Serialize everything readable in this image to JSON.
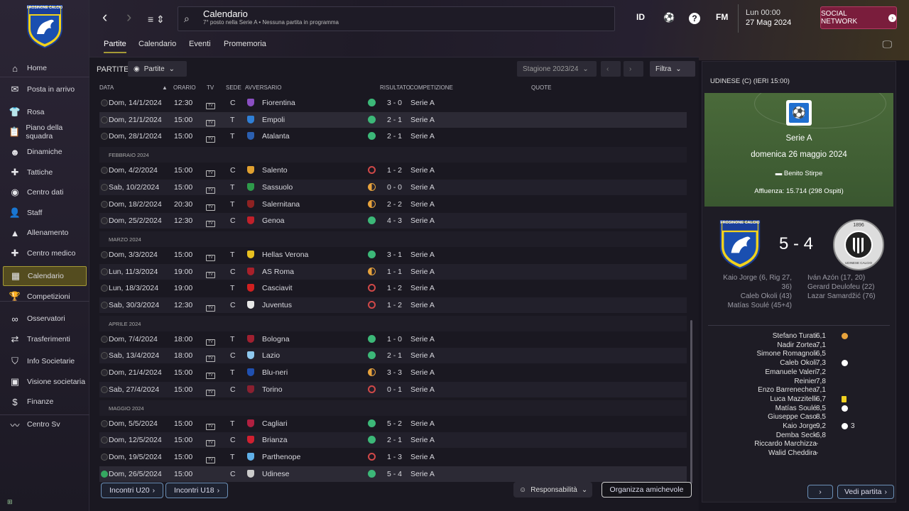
{
  "club_logo_text": "FROSINONE CALCIO",
  "sidebar": [
    {
      "label": "Home",
      "icon": "home-icon",
      "glyph": "⌂"
    },
    {
      "label": "Posta in arrivo",
      "icon": "mail-icon",
      "glyph": "✉"
    },
    {
      "label": "Rosa",
      "icon": "squad-icon",
      "glyph": "👕"
    },
    {
      "label": "Piano della squadra",
      "icon": "clipboard-icon",
      "glyph": "📋"
    },
    {
      "label": "Dinamiche",
      "icon": "dynamics-icon",
      "glyph": "☻"
    },
    {
      "label": "Tattiche",
      "icon": "tactics-icon",
      "glyph": "✚"
    },
    {
      "label": "Centro dati",
      "icon": "data-icon",
      "glyph": "◉"
    },
    {
      "label": "Staff",
      "icon": "staff-icon",
      "glyph": "👤"
    },
    {
      "label": "Allenamento",
      "icon": "training-icon",
      "glyph": "▲"
    },
    {
      "label": "Centro medico",
      "icon": "medical-icon",
      "glyph": "✚"
    },
    {
      "label": "Calendario",
      "icon": "calendar-icon",
      "glyph": "▦",
      "active": true
    },
    {
      "label": "Competizioni",
      "icon": "trophy-icon",
      "glyph": "🏆"
    },
    {
      "label": "Osservatori",
      "icon": "binoculars-icon",
      "glyph": "∞"
    },
    {
      "label": "Trasferimenti",
      "icon": "transfers-icon",
      "glyph": "⇄"
    },
    {
      "label": "Info Societarie",
      "icon": "shield-icon",
      "glyph": "⛉"
    },
    {
      "label": "Visione societaria",
      "icon": "briefcase-icon",
      "glyph": "▣"
    },
    {
      "label": "Finanze",
      "icon": "finance-icon",
      "glyph": "$"
    },
    {
      "label": "Centro Sv",
      "icon": "development-icon",
      "glyph": "〰"
    }
  ],
  "header": {
    "title": "Calendario",
    "subtitle": "7° posto nella Serie A • Nessuna partita in programma",
    "id_label": "ID",
    "fm_label": "FM",
    "help": "?",
    "day_time": "Lun 00:00",
    "date": "27 Mag 2024",
    "social": "SOCIAL NETWORK"
  },
  "tabs": [
    "Partite",
    "Calendario",
    "Eventi",
    "Promemoria"
  ],
  "list": {
    "heading": "PARTITE",
    "view_btn": "Partite",
    "season": "Stagione 2023/24",
    "filter": "Filtra",
    "columns": {
      "date": "DATA",
      "time": "ORARIO",
      "tv": "TV",
      "venue": "SEDE",
      "opp": "AVVERSARIO",
      "res": "RISULTATO",
      "comp": "COMPETIZIONE",
      "odds": "QUOTE"
    }
  },
  "matches": [
    {
      "type": "m",
      "date": "Dom, 14/1/2024",
      "time": "12:30",
      "tv": true,
      "venue": "C",
      "opp": "Fiorentina",
      "crest": "#8a4fc2",
      "r": "W",
      "score": "3 - 0",
      "comp": "Serie A"
    },
    {
      "type": "m",
      "date": "Dom, 21/1/2024",
      "time": "15:00",
      "tv": true,
      "venue": "T",
      "opp": "Empoli",
      "crest": "#2f7fd6",
      "r": "W",
      "score": "2 - 1",
      "comp": "Serie A"
    },
    {
      "type": "m",
      "date": "Dom, 28/1/2024",
      "time": "15:00",
      "tv": true,
      "venue": "T",
      "opp": "Atalanta",
      "crest": "#2b5fb0",
      "r": "W",
      "score": "2 - 1",
      "comp": "Serie A"
    },
    {
      "type": "h",
      "label": "FEBBRAIO 2024"
    },
    {
      "type": "m",
      "date": "Dom, 4/2/2024",
      "time": "15:00",
      "tv": true,
      "venue": "C",
      "opp": "Salento",
      "crest": "#e0a030",
      "r": "L",
      "score": "1 - 2",
      "comp": "Serie A"
    },
    {
      "type": "m",
      "date": "Sab, 10/2/2024",
      "time": "15:00",
      "tv": true,
      "venue": "T",
      "opp": "Sassuolo",
      "crest": "#2e9a4a",
      "r": "D",
      "score": "0 - 0",
      "comp": "Serie A"
    },
    {
      "type": "m",
      "date": "Dom, 18/2/2024",
      "time": "20:30",
      "tv": true,
      "venue": "T",
      "opp": "Salernitana",
      "crest": "#8e2222",
      "r": "D",
      "score": "2 - 2",
      "comp": "Serie A"
    },
    {
      "type": "m",
      "date": "Dom, 25/2/2024",
      "time": "12:30",
      "tv": true,
      "venue": "C",
      "opp": "Genoa",
      "crest": "#c0202a",
      "r": "W",
      "score": "4 - 3",
      "comp": "Serie A"
    },
    {
      "type": "h",
      "label": "MARZO 2024"
    },
    {
      "type": "m",
      "date": "Dom, 3/3/2024",
      "time": "15:00",
      "tv": true,
      "venue": "T",
      "opp": "Hellas Verona",
      "crest": "#e8c020",
      "r": "W",
      "score": "3 - 1",
      "comp": "Serie A"
    },
    {
      "type": "m",
      "date": "Lun, 11/3/2024",
      "time": "19:00",
      "tv": true,
      "venue": "C",
      "opp": "AS Roma",
      "crest": "#a8202a",
      "r": "D",
      "score": "1 - 1",
      "comp": "Serie A"
    },
    {
      "type": "m",
      "date": "Lun, 18/3/2024",
      "time": "19:00",
      "tv": false,
      "venue": "T",
      "opp": "Casciavit",
      "crest": "#d02020",
      "r": "L",
      "score": "1 - 2",
      "comp": "Serie A"
    },
    {
      "type": "m",
      "date": "Sab, 30/3/2024",
      "time": "12:30",
      "tv": true,
      "venue": "C",
      "opp": "Juventus",
      "crest": "#e8e8e8",
      "r": "L",
      "score": "1 - 2",
      "comp": "Serie A"
    },
    {
      "type": "h",
      "label": "APRILE 2024"
    },
    {
      "type": "m",
      "date": "Dom, 7/4/2024",
      "time": "18:00",
      "tv": true,
      "venue": "T",
      "opp": "Bologna",
      "crest": "#a02030",
      "r": "W",
      "score": "1 - 0",
      "comp": "Serie A"
    },
    {
      "type": "m",
      "date": "Sab, 13/4/2024",
      "time": "18:00",
      "tv": true,
      "venue": "C",
      "opp": "Lazio",
      "crest": "#8ec8ee",
      "r": "W",
      "score": "2 - 1",
      "comp": "Serie A"
    },
    {
      "type": "m",
      "date": "Dom, 21/4/2024",
      "time": "15:00",
      "tv": true,
      "venue": "T",
      "opp": "Blu-neri",
      "crest": "#2050b0",
      "r": "D",
      "score": "3 - 3",
      "comp": "Serie A"
    },
    {
      "type": "m",
      "date": "Sab, 27/4/2024",
      "time": "15:00",
      "tv": true,
      "venue": "C",
      "opp": "Torino",
      "crest": "#8a2030",
      "r": "L",
      "score": "0 - 1",
      "comp": "Serie A"
    },
    {
      "type": "h",
      "label": "MAGGIO 2024"
    },
    {
      "type": "m",
      "date": "Dom, 5/5/2024",
      "time": "15:00",
      "tv": true,
      "venue": "T",
      "opp": "Cagliari",
      "crest": "#b02040",
      "r": "W",
      "score": "5 - 2",
      "comp": "Serie A"
    },
    {
      "type": "m",
      "date": "Dom, 12/5/2024",
      "time": "15:00",
      "tv": true,
      "venue": "C",
      "opp": "Brianza",
      "crest": "#d02030",
      "r": "W",
      "score": "2 - 1",
      "comp": "Serie A"
    },
    {
      "type": "m",
      "date": "Dom, 19/5/2024",
      "time": "15:00",
      "tv": true,
      "venue": "T",
      "opp": "Parthenope",
      "crest": "#60b0e8",
      "r": "L",
      "score": "1 - 3",
      "comp": "Serie A"
    },
    {
      "type": "m",
      "date": "Dom, 26/5/2024",
      "time": "15:00",
      "tv": false,
      "venue": "C",
      "opp": "Udinese",
      "crest": "#cccccc",
      "r": "W",
      "score": "5 - 4",
      "comp": "Serie A",
      "done": true
    }
  ],
  "footer": {
    "u20": "Incontri U20",
    "u18": "Incontri U18",
    "resp": "Responsabilità",
    "friendly": "Organizza amichevole"
  },
  "panel": {
    "title": "UDINESE (C) (IERI 15:00)",
    "comp": "Serie A",
    "date": "domenica 26 maggio 2024",
    "stadium": "Benito Stirpe",
    "attendance": "Affluenza: 15.714 (298 Ospiti)",
    "home_logo": "FROSINONE CALCIO",
    "away_logo": "UDINESE CALCIO",
    "away_year": "1896",
    "score": "5 - 4",
    "home_scorers": [
      "Kaio Jorge (6, Rig 27,",
      "36)",
      "Caleb Okoli (43)",
      "Matías Soulé (45+4)"
    ],
    "away_scorers": [
      "Iván Azón (17, 20)",
      "Gerard Deulofeu (22)",
      "Lazar Samardžić (76)"
    ],
    "players": [
      {
        "n": "Stefano Turati",
        "r": "6,1",
        "i": "ball-gold"
      },
      {
        "n": "Nadir Zortea",
        "r": "7,1"
      },
      {
        "n": "Simone Romagnoli",
        "r": "6,5"
      },
      {
        "n": "Caleb Okoli",
        "r": "7,3",
        "i": "ball"
      },
      {
        "n": "Emanuele Valeri",
        "r": "7,2"
      },
      {
        "n": "Reinier",
        "r": "7,8"
      },
      {
        "n": "Enzo Barrenechea",
        "r": "7,1"
      },
      {
        "n": "Luca Mazzitelli",
        "r": "6,7",
        "i": "yellow"
      },
      {
        "n": "Matías Soulé",
        "r": "8,5",
        "i": "ball"
      },
      {
        "n": "Giuseppe Caso",
        "r": "8,5"
      },
      {
        "n": "Kaio Jorge",
        "r": "9,2",
        "i": "ball",
        "c": "3"
      },
      {
        "n": "Demba Seck",
        "r": "6,8"
      },
      {
        "n": "Riccardo Marchizza",
        "r": "-"
      },
      {
        "n": "Walid Cheddira",
        "r": "-"
      }
    ],
    "next": "›",
    "view": "Vedi partita"
  }
}
